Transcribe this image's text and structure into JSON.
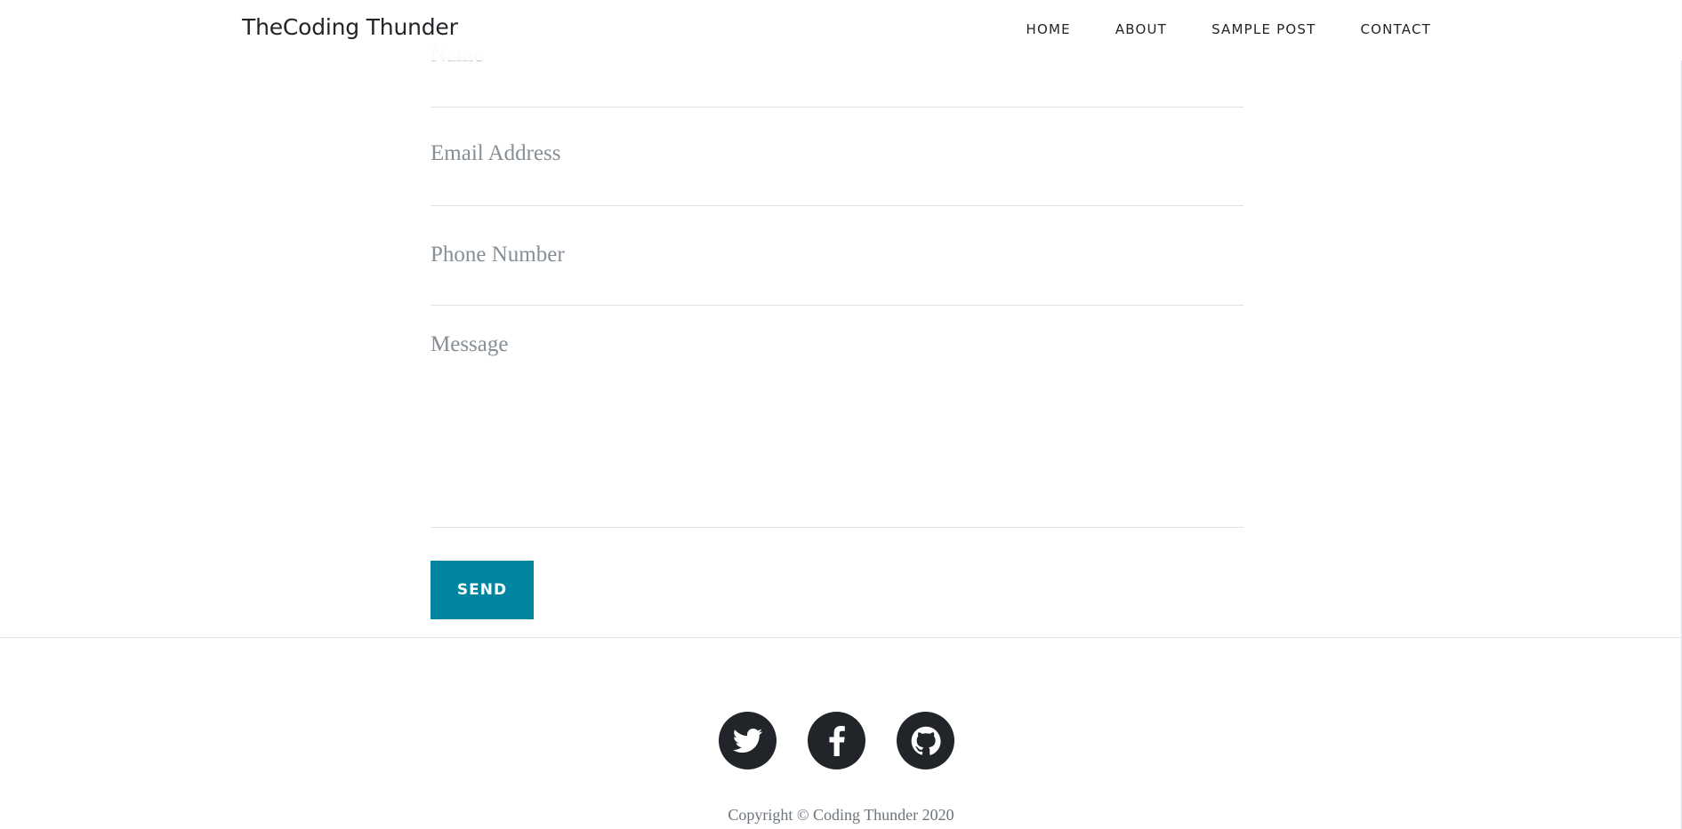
{
  "navbar": {
    "brand": "TheCoding Thunder",
    "links": [
      {
        "label": "HOME"
      },
      {
        "label": "ABOUT"
      },
      {
        "label": "SAMPLE POST"
      },
      {
        "label": "CONTACT"
      }
    ]
  },
  "form": {
    "name_placeholder": "Name",
    "email_placeholder": "Email Address",
    "phone_placeholder": "Phone Number",
    "message_placeholder": "Message",
    "send_label": "SEND"
  },
  "colors": {
    "accent": "#0085a1",
    "social_bg": "#212529"
  },
  "footer": {
    "social": [
      {
        "icon": "twitter-icon"
      },
      {
        "icon": "facebook-icon"
      },
      {
        "icon": "github-icon"
      }
    ],
    "copyright": "Copyright © Coding Thunder 2020"
  }
}
